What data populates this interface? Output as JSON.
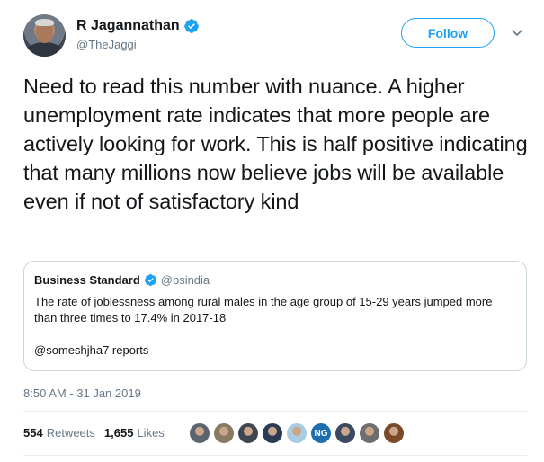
{
  "author": {
    "display_name": "R Jagannathan",
    "handle": "@TheJaggi",
    "avatar_icon": "user-avatar",
    "verified_icon": "verified-badge-icon"
  },
  "follow_button": {
    "label": "Follow"
  },
  "caret_icon": "chevron-down-icon",
  "tweet": {
    "text": "Need to read this number with nuance. A higher unemployment rate indicates that more people are actively looking for work. This is half positive indicating that many millions now believe jobs will be available even if not of satisfactory kind"
  },
  "quoted_tweet": {
    "display_name": "Business Standard",
    "handle": "@bsindia",
    "text": "The rate of joblessness among rural males in the age group of 15-29 years jumped more than three times to 17.4% in 2017-18",
    "reports": "@someshjha7 reports"
  },
  "timestamp": "8:50 AM - 31 Jan 2019",
  "stats": {
    "retweets_count": "554",
    "retweets_label": "Retweets",
    "likes_count": "1,655",
    "likes_label": "Likes"
  },
  "likers": [
    {
      "color": "#5b6470"
    },
    {
      "color": "#8a7a62"
    },
    {
      "color": "#3f4652"
    },
    {
      "color": "#2d3a55"
    },
    {
      "color": "#a8cde3"
    },
    {
      "color": "#1f6fb0",
      "label": "NG"
    },
    {
      "color": "#3a4a63"
    },
    {
      "color": "#6e6e6e"
    },
    {
      "color": "#7a4a2a"
    }
  ],
  "colors": {
    "accent": "#1da1f2",
    "text": "#14171a",
    "secondary": "#657786",
    "border": "#ccd6dd"
  }
}
